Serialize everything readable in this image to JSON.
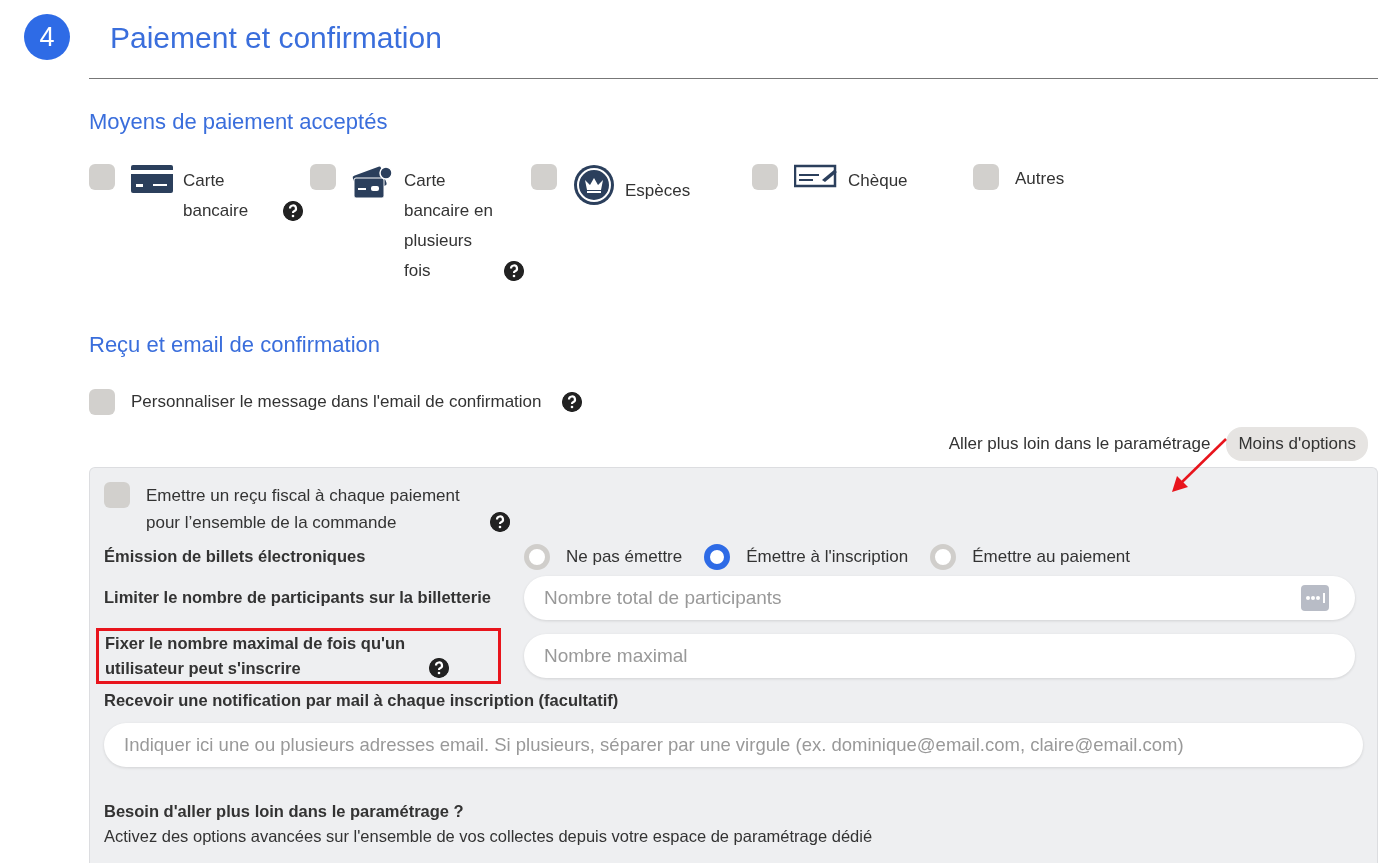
{
  "step": {
    "number": "4",
    "title": "Paiement et confirmation"
  },
  "payment_section": {
    "title": "Moyens de paiement acceptés",
    "methods": [
      {
        "kind": "card",
        "label": "Carte bancaire",
        "checked": false,
        "help": true
      },
      {
        "kind": "multi_card",
        "label": "Carte bancaire en plusieurs fois",
        "checked": false,
        "help": true
      },
      {
        "kind": "cash",
        "label": "Espèces",
        "checked": false,
        "help": false
      },
      {
        "kind": "cheque",
        "label": "Chèque",
        "checked": false,
        "help": false
      },
      {
        "kind": "none",
        "label": "Autres",
        "checked": false,
        "help": false
      }
    ]
  },
  "receipt_section": {
    "title": "Reçu et email de confirmation",
    "customize": {
      "label": "Personnaliser le message dans l'email de confirmation",
      "checked": false
    }
  },
  "options_bar": {
    "text": "Aller plus loin dans le paramétrage",
    "button": "Moins d'options"
  },
  "advanced": {
    "tax_receipt": {
      "label": "Emettre un reçu fiscal à chaque paiement pour l’ensemble de la commande",
      "checked": false
    },
    "tickets": {
      "label": "Émission de billets électroniques",
      "options": [
        {
          "label": "Ne pas émettre",
          "selected": false
        },
        {
          "label": "Émettre à l'inscription",
          "selected": true
        },
        {
          "label": "Émettre au paiement",
          "selected": false
        }
      ]
    },
    "limit": {
      "label": "Limiter le nombre de participants sur la billetterie",
      "placeholder": "Nombre total de participants"
    },
    "max": {
      "label": "Fixer le nombre maximal de fois qu'un utilisateur peut s'inscrire",
      "placeholder": "Nombre maximal",
      "highlighted": true
    },
    "notify": {
      "label": "Recevoir une notification par mail à chaque inscription (facultatif)",
      "placeholder": "Indiquer ici une ou plusieurs adresses email. Si plusieurs, séparer par une virgule (ex. dominique@email.com, claire@email.com)"
    },
    "more": {
      "title": "Besoin d'aller plus loin dans le paramétrage ?",
      "text": "Activez des options avancées sur l'ensemble de vos collectes depuis votre espace de paramétrage dédié"
    }
  }
}
